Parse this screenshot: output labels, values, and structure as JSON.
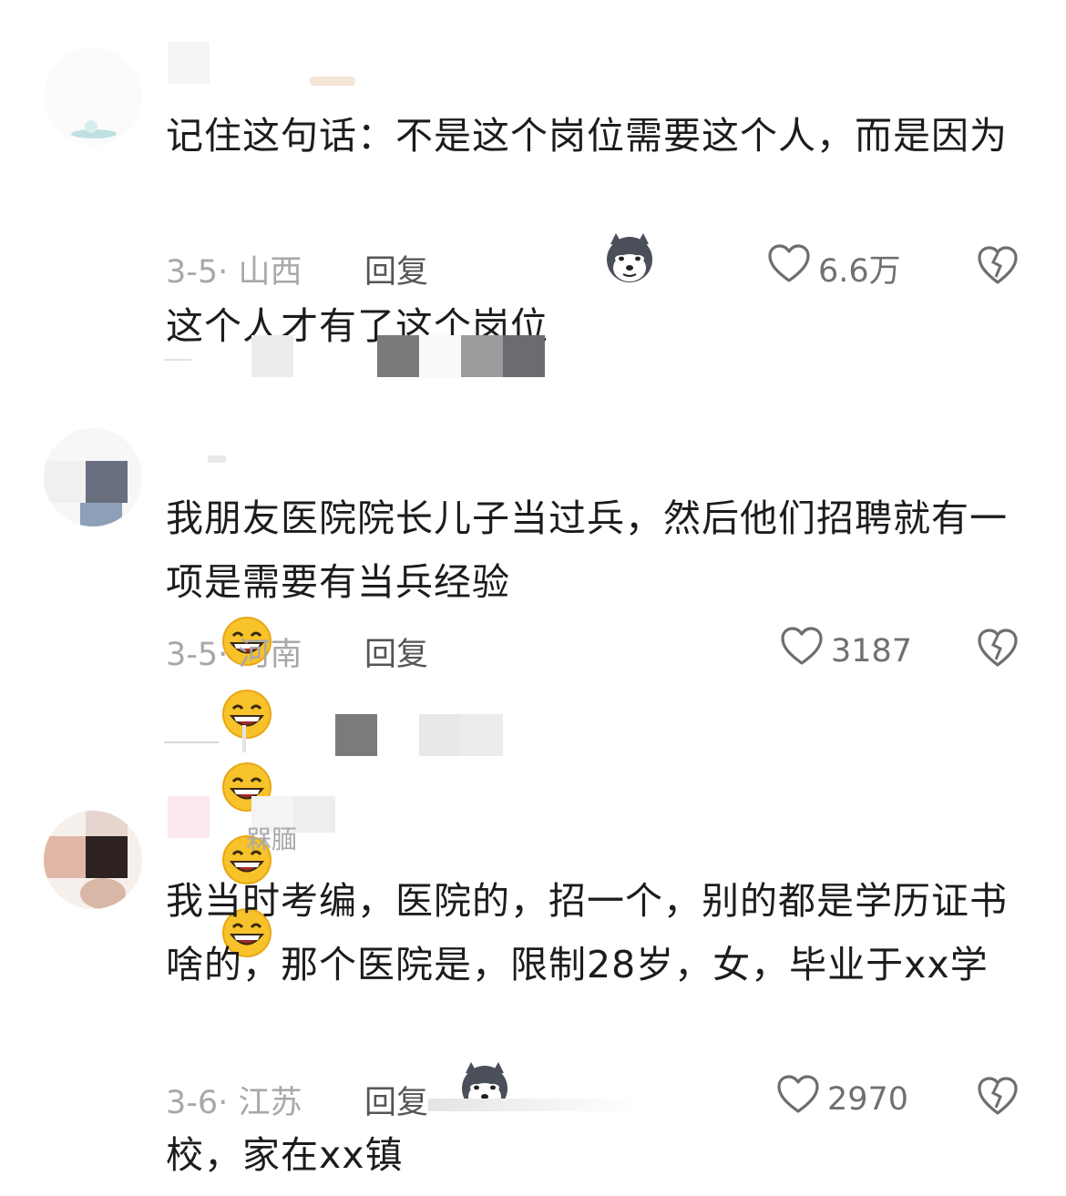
{
  "comments": [
    {
      "text": "记住这句话：不是这个岗位需要这个人，而是因为这个人才有了这个岗位",
      "emoji": "husky-emoji",
      "date": "3-5",
      "location": "山西",
      "reply_label": "回复",
      "likes": "6.6万"
    },
    {
      "text": "我朋友医院院长儿子当过兵，然后他们招聘就有一项是需要有当兵经验",
      "emoji": "grin-emoji",
      "emoji_count": 5,
      "date": "3-5",
      "location": "河南",
      "reply_label": "回复",
      "likes": "3187"
    },
    {
      "username_fragment": "槑腼",
      "text": "我当时考编，医院的，招一个，别的都是学历证书啥的，那个医院是，限制28岁，女，毕业于xx学校，家在xx镇",
      "emoji": "husky-emoji",
      "date": "3-6",
      "location": "江苏",
      "reply_label": "回复",
      "likes": "2970"
    }
  ],
  "colors": {
    "text": "#1c1c1c",
    "meta": "#a8a8a8",
    "reply": "#555555",
    "likes": "#707070"
  }
}
